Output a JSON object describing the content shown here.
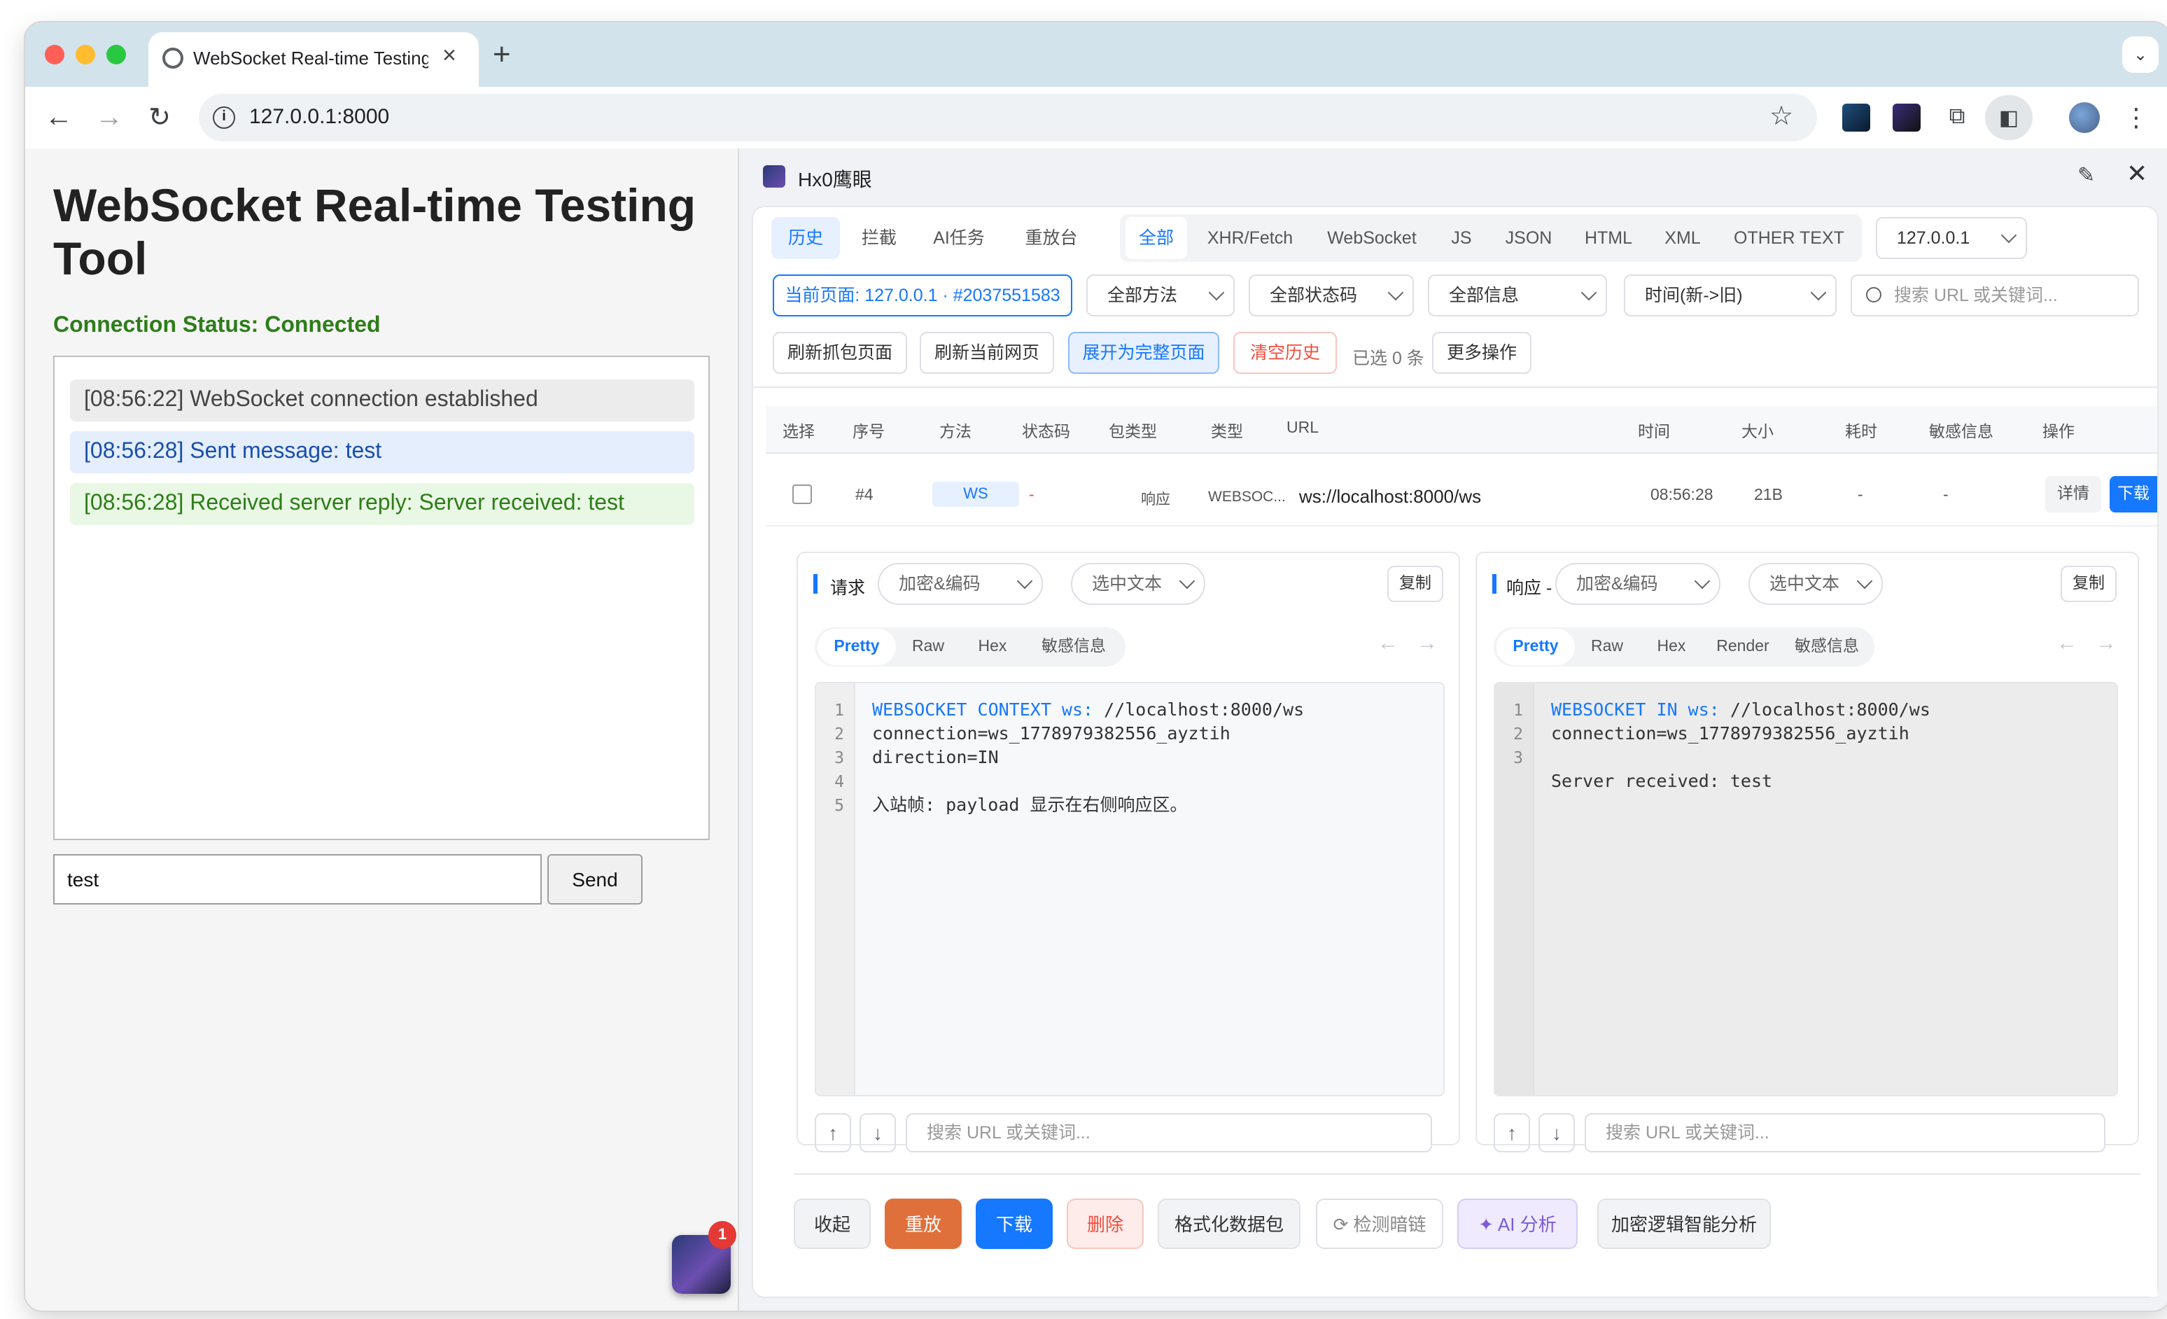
{
  "browser": {
    "tab_title": "WebSocket Real-time Testing Tool",
    "tab_close": "×",
    "new_tab": "+",
    "url": "127.0.0.1:8000",
    "colors": {
      "close": "#ff5f57",
      "minimize": "#febc2e",
      "maximize": "#28c840"
    }
  },
  "left": {
    "title": "WebSocket Real-time Testing Tool",
    "status": "Connection Status: Connected",
    "logs": [
      {
        "text": "[08:56:22] WebSocket connection established",
        "kind": "info"
      },
      {
        "text": "[08:56:28] Sent message: test",
        "kind": "sent"
      },
      {
        "text": "[08:56:28] Received server reply: Server received: test",
        "kind": "recv"
      }
    ],
    "input_value": "test",
    "send_label": "Send",
    "badge_count": "1"
  },
  "panel": {
    "title": "Hx0鹰眼",
    "top_tabs": [
      "历史",
      "拦截",
      "AI任务",
      "重放台"
    ],
    "filter_tabs": [
      "全部",
      "XHR/Fetch",
      "WebSocket",
      "JS",
      "JSON",
      "HTML",
      "XML",
      "OTHER TEXT"
    ],
    "host_select": "127.0.0.1",
    "current_page": "当前页面: 127.0.0.1 · #2037551583",
    "method_select": "全部方法",
    "status_select": "全部状态码",
    "info_select": "全部信息",
    "sort_select": "时间(新->旧)",
    "search_placeholder": "搜索 URL 或关键词...",
    "actions": {
      "refresh_capture": "刷新抓包页面",
      "refresh_page": "刷新当前网页",
      "expand": "展开为完整页面",
      "clear": "清空历史",
      "selected": "已选 0 条",
      "more": "更多操作"
    },
    "table_headers": [
      "选择",
      "序号",
      "方法",
      "状态码",
      "包类型",
      "类型",
      "URL",
      "时间",
      "大小",
      "耗时",
      "敏感信息",
      "操作"
    ],
    "row": {
      "index": "#4",
      "method": "WS",
      "status": "-",
      "packet_type": "响应",
      "type": "WEBSOC...",
      "url": "ws://localhost:8000/ws",
      "time": "08:56:28",
      "size": "21B",
      "duration": "-",
      "sensitive": "-",
      "detail": "详情",
      "download": "下载"
    },
    "request": {
      "label": "请求",
      "encode_select": "加密&编码",
      "text_select": "选中文本",
      "copy": "复制",
      "subtabs": [
        "Pretty",
        "Raw",
        "Hex",
        "敏感信息"
      ],
      "line_numbers": "1\n2\n3\n4\n5",
      "code_key": "WEBSOCKET CONTEXT ws:",
      "code_rest": " //localhost:8000/ws\nconnection=ws_1778979382556_ayztih\ndirection=IN\n\n入站帧: payload 显示在右侧响应区。",
      "search_placeholder": "搜索 URL 或关键词..."
    },
    "response": {
      "label": "响应 -",
      "encode_select": "加密&编码",
      "text_select": "选中文本",
      "copy": "复制",
      "subtabs": [
        "Pretty",
        "Raw",
        "Hex",
        "Render",
        "敏感信息"
      ],
      "line_numbers": "1\n2\n3",
      "code_key": "WEBSOCKET IN ws:",
      "code_rest": " //localhost:8000/ws\nconnection=ws_1778979382556_ayztih\n\nServer received: test",
      "search_placeholder": "搜索 URL 或关键词..."
    },
    "bottom_actions": {
      "collapse": "收起",
      "replay": "重放",
      "download": "下载",
      "delete": "删除",
      "format": "格式化数据包",
      "detect": "检测暗链",
      "ai": "AI 分析",
      "crypto": "加密逻辑智能分析"
    },
    "colors": {
      "primary": "#1677ff",
      "danger": "#f04e3e",
      "replay": "#e0703b",
      "ai": "#7b5cd6"
    }
  }
}
